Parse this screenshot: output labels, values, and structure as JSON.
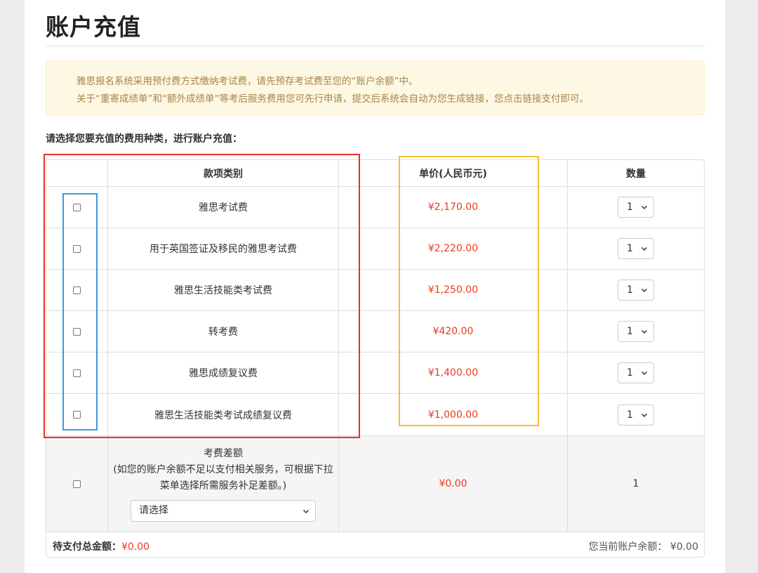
{
  "page": {
    "title": "账户充值",
    "notice_line1": "雅思报名系统采用预付费方式缴纳考试费，请先预存考试费至您的“账户余额”中。",
    "notice_line2": "关于“重寄成绩单”和“额外成绩单”等考后服务费用您可先行申请，提交后系统会自动为您生成链接，您点击链接支付即可。",
    "instruction": "请选择您要充值的费用种类，进行账户充值："
  },
  "table": {
    "headers": [
      "",
      "款项类别",
      "单价(人民币元)",
      "数量"
    ],
    "rows": [
      {
        "name": "雅思考试费",
        "price": "¥2,170.00",
        "qty": "1"
      },
      {
        "name": "用于英国签证及移民的雅思考试费",
        "price": "¥2,220.00",
        "qty": "1"
      },
      {
        "name": "雅思生活技能类考试费",
        "price": "¥1,250.00",
        "qty": "1"
      },
      {
        "name": "转考费",
        "price": "¥420.00",
        "qty": "1"
      },
      {
        "name": "雅思成绩复议费",
        "price": "¥1,400.00",
        "qty": "1"
      },
      {
        "name": "雅思生活技能类考试成绩复议费",
        "price": "¥1,000.00",
        "qty": "1"
      }
    ],
    "gap_row": {
      "title": "考费差额",
      "desc": "(如您的账户余额不足以支付相关服务，可根据下拉菜单选择所需服务补足差额。)",
      "select_value": "请选择",
      "price": "¥0.00",
      "qty": "1"
    }
  },
  "footer": {
    "total_label": "待支付总金额：",
    "total_value": "¥0.00",
    "balance": "您当前账户余额： ¥0.00"
  },
  "colors": {
    "price": "#ee3a1c",
    "notice_bg": "#fcf8e3",
    "notice_text": "#a9834a",
    "annotation_red": "#e8302b",
    "annotation_blue": "#3a9bdc",
    "annotation_yellow": "#f6c02b"
  },
  "icons": {
    "select_arrow": "chevron-down-icon"
  }
}
